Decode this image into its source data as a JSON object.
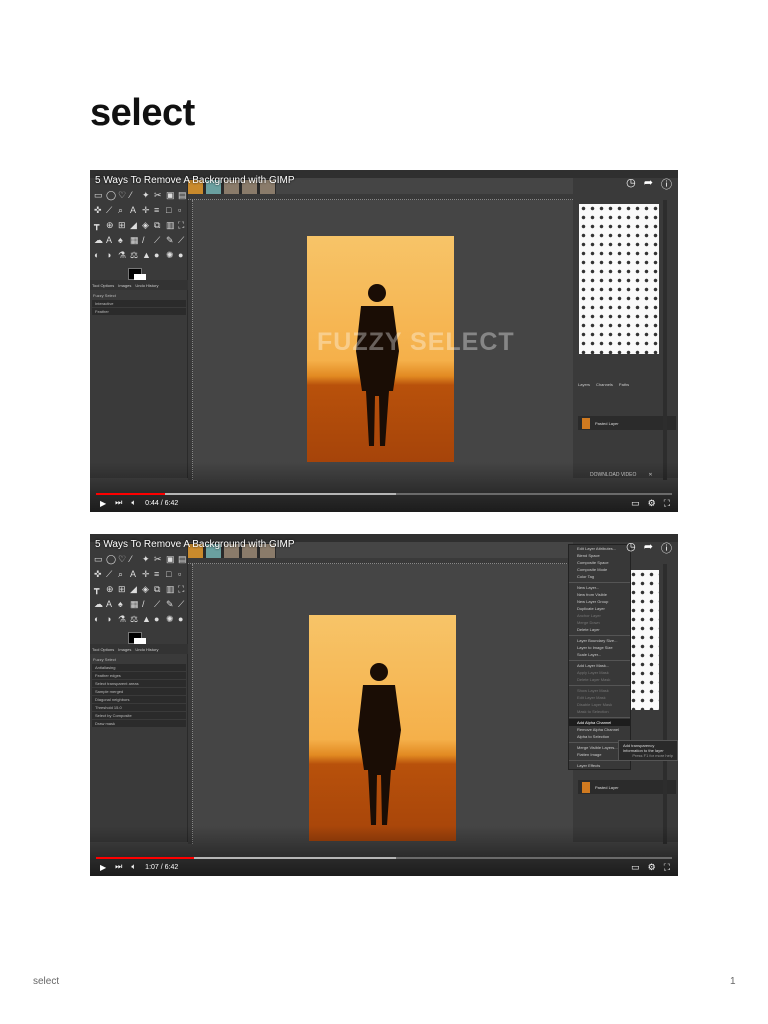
{
  "page": {
    "title": "select",
    "footer_left": "select",
    "page_number": "1"
  },
  "videos": [
    {
      "title": "5 Ways To Remove A Background with GIMP",
      "time": "0:44 / 6:42",
      "played_fraction": 0.12,
      "buffered_fraction": 0.52,
      "watermark": "FUZZY SELECT",
      "download": "DOWNLOAD VIDEO",
      "left_tabs": [
        "Tool Options",
        "Images",
        "Undo History"
      ],
      "left_options": [
        "Fuzzy Select",
        "Interactive",
        "Feather"
      ],
      "right_tabs": [
        "Layers",
        "Channels",
        "Paths"
      ],
      "layer_name": "Pasted Layer"
    },
    {
      "title": "5 Ways To Remove A Background with GIMP",
      "time": "1:07 / 6:42",
      "played_fraction": 0.17,
      "buffered_fraction": 0.52,
      "left_tabs": [
        "Tool Options",
        "Images",
        "Undo History"
      ],
      "left_options": [
        "Fuzzy Select",
        "Antialiasing",
        "Feather edges",
        "Select transparent areas",
        "Sample merged",
        "Diagonal neighbors",
        "Threshold 15.0",
        "Select by Composite",
        "Draw mask"
      ],
      "layer_name": "Pasted Layer",
      "menu": [
        "Edit Layer Attributes...",
        "Blend Space",
        "Composite Space",
        "Composite Mode",
        "Color Tag",
        "-",
        "New Layer...",
        "New from Visible",
        "New Layer Group",
        "Duplicate Layer",
        "Anchor Layer",
        "Merge Down",
        "Delete Layer",
        "-",
        "Layer Boundary Size...",
        "Layer to Image Size",
        "Scale Layer...",
        "-",
        "Add Layer Mask...",
        "Apply Layer Mask",
        "Delete Layer Mask",
        "-",
        "Show Layer Mask",
        "Edit Layer Mask",
        "Disable Layer Mask",
        "Mask to Selection",
        "-",
        "Add Alpha Channel",
        "Remove Alpha Channel",
        "Alpha to Selection",
        "-",
        "Merge Visible Layers...",
        "Flatten Image",
        "-",
        "Layer Effects"
      ],
      "highlighted": "Add Alpha Channel",
      "tooltip": "Add transparency information to the layer",
      "tooltip_help": "Press F1 for more help"
    }
  ]
}
